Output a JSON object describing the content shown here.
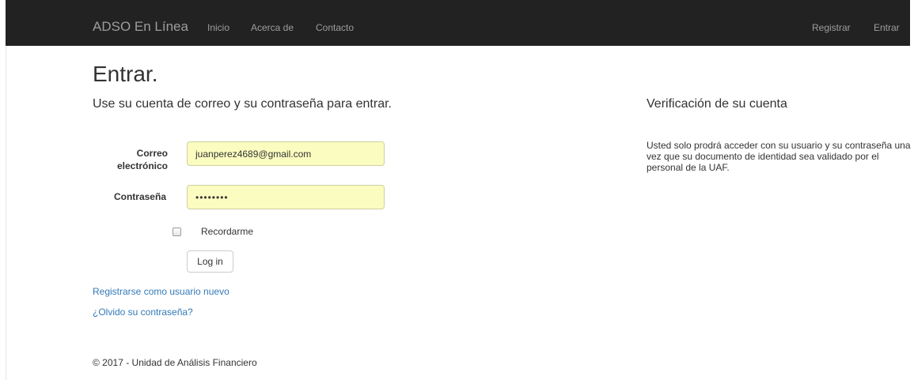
{
  "navbar": {
    "brand": "ADSO En Línea",
    "left_links": [
      "Inicio",
      "Acerca de",
      "Contacto"
    ],
    "right_links": [
      "Registrar",
      "Entrar"
    ]
  },
  "main": {
    "title": "Entrar.",
    "subtitle": "Use su cuenta de correo y su contraseña para entrar.",
    "form": {
      "email_label_line1": "Correo",
      "email_label_line2": "electrónico",
      "email_value": "juanperez4689@gmail.com",
      "password_label": "Contraseña",
      "password_value": "••••••••",
      "remember_label": "Recordarme",
      "remember_checked": false,
      "submit_label": "Log in"
    },
    "links": {
      "register": "Registrarse como usuario nuevo",
      "forgot": "¿Olvido su contraseña?"
    }
  },
  "side": {
    "title": "Verificación de su cuenta",
    "text": "Usted solo prodrá acceder con su usuario y su contraseña una vez que su documento de identidad sea validado por el personal de la UAF."
  },
  "footer": {
    "text": "© 2017 - Unidad de Análisis Financiero"
  },
  "colors": {
    "navbar_bg": "#222222",
    "nav_text": "#9d9d9d",
    "link": "#337ab7",
    "autofill_bg": "#fbfdc0"
  }
}
